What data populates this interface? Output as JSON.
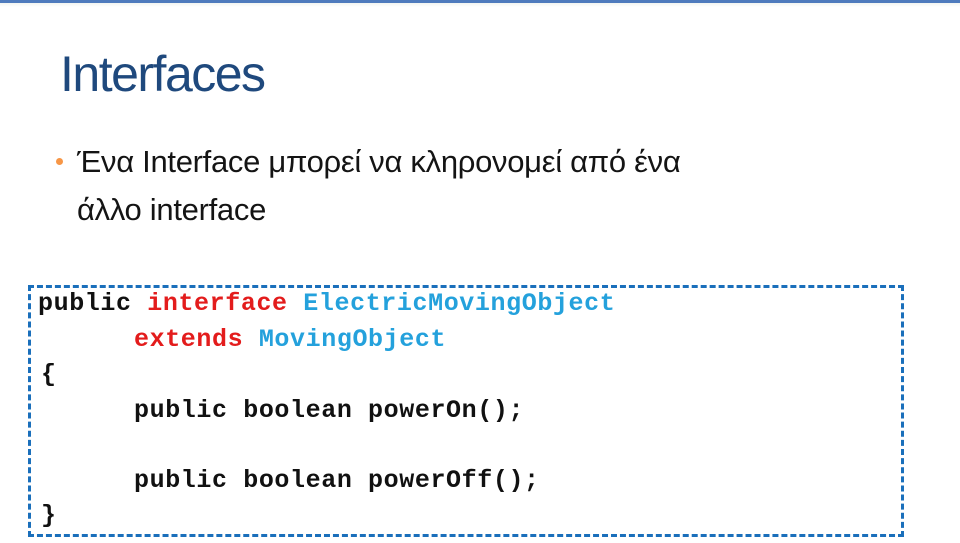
{
  "slide": {
    "title": "Interfaces",
    "accent_colors": {
      "top_bar": "#4f7bbd",
      "title": "#1f497d",
      "bullet": "#f79646",
      "code_border": "#1a6fbb",
      "keyword": "#e31c1c",
      "type_name": "#24a1dc"
    },
    "bullets": [
      {
        "line1": "Ένα Interface μπορεί να κληρονομεί από ένα",
        "line2": "άλλο interface"
      }
    ],
    "code": {
      "line1": {
        "modifier": "public",
        "keyword": "interface",
        "type_name": "ElectricMovingObject"
      },
      "line2": {
        "keyword": "extends",
        "type_name": "MovingObject"
      },
      "open_brace": "{",
      "method1": "public boolean powerOn();",
      "method2": "public boolean powerOff();",
      "close_brace": "}"
    }
  }
}
